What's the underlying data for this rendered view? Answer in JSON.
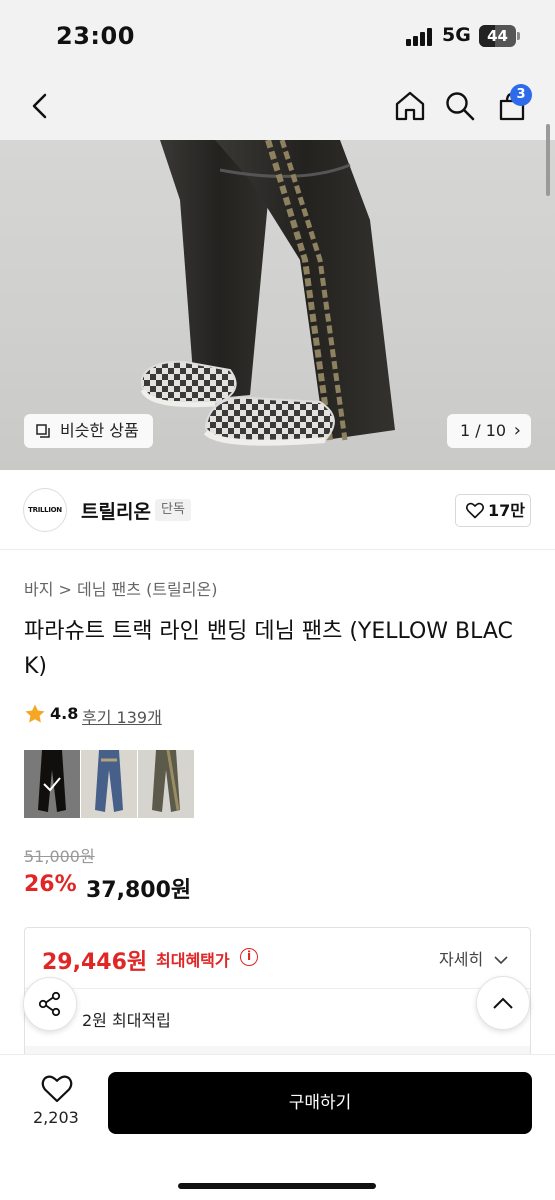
{
  "status": {
    "time": "23:00",
    "network": "5G",
    "battery": "44",
    "battery_level": 0.44
  },
  "nav": {
    "back_icon": "chevron-left-icon",
    "home_icon": "home-icon",
    "search_icon": "search-icon",
    "cart_icon": "cart-icon",
    "cart_count": "3"
  },
  "hero": {
    "similar_label": "비슷한 상품",
    "pager": "1 / 10"
  },
  "brand": {
    "logo_text": "TRILLION",
    "name": "트릴리온",
    "tag": "단독",
    "like_count": "17만"
  },
  "product": {
    "breadcrumb": "바지 > 데님 팬츠 (트릴리온)",
    "title": "파라슈트 트랙 라인 밴딩 데님 팬츠 (YELLOW BLACK)",
    "rating": "4.8",
    "reviews": "후기 139개",
    "original_price": "51,000원",
    "discount": "26%",
    "sale_price": "37,800원"
  },
  "benefit": {
    "max_price": "29,446원",
    "max_label": "최대혜택가",
    "detail_label": "자세히",
    "points": "2원 최대적립"
  },
  "bottom": {
    "wish_count": "2,203",
    "buy_label": "구매하기"
  },
  "colors": {
    "accent_red": "#e12626",
    "badge_blue": "#2d6bea",
    "buy_button": "#000000"
  }
}
